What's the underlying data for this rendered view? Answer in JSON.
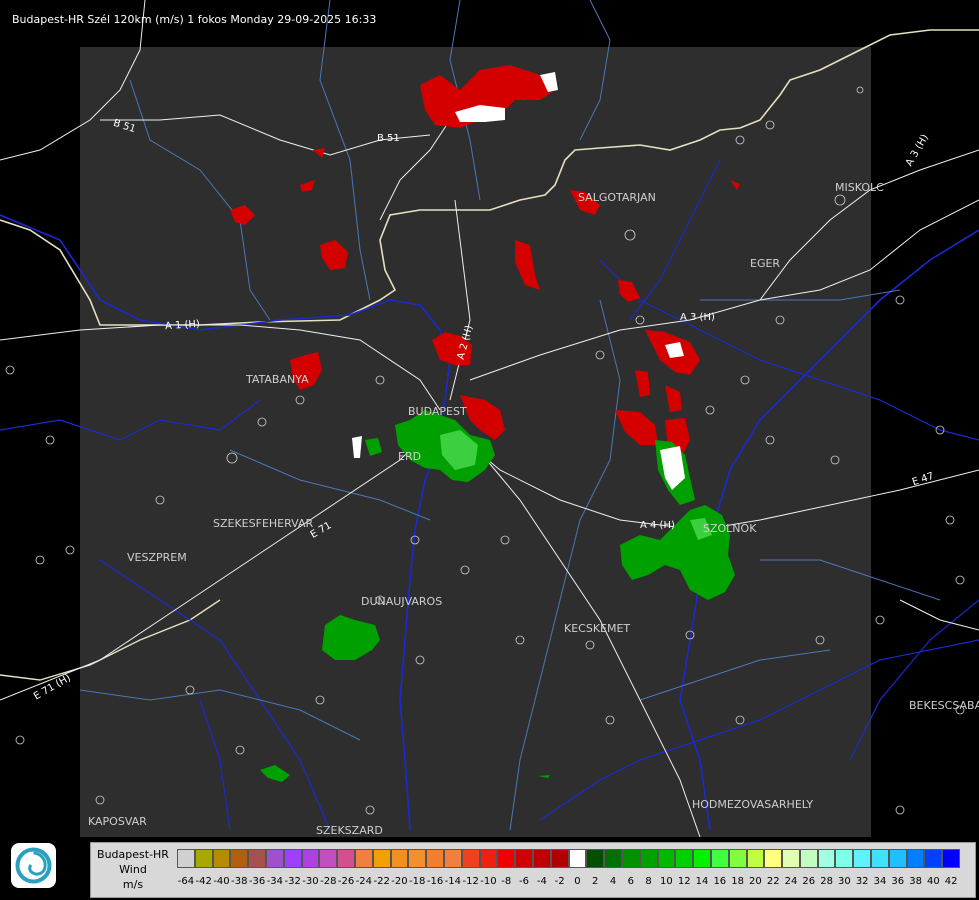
{
  "header": "Budapest-HR Szél 120km (m/s) 1 fokos Monday 29-09-2025 16:33",
  "cities": {
    "salgotarjan": "SALGOTARJAN",
    "miskolc": "MISKOLC",
    "eger": "EGER",
    "tatabanya": "TATABANYA",
    "budapest": "BUDAPEST",
    "erd": "ERD",
    "szekesfehervar": "SZEKESFEHERVAR",
    "veszprem": "VESZPREM",
    "dunaujvaros": "DUNAUJVAROS",
    "kecskemet": "KECSKEMET",
    "szolnok": "SZOLNOK",
    "bekescsaba": "BEKESCSABA",
    "hodmezovasarhely": "HODMEZOVASARHELY",
    "kaposvar": "KAPOSVAR",
    "szekszard": "SZEKSZARD"
  },
  "roads": {
    "b51_left": "B 51",
    "b51_right": "B 51",
    "a1": "A 1 (H)",
    "a2": "A 2 (H)",
    "a3": "A 3 (H)",
    "a3_ne": "A 3 (H)",
    "a4": "A 4 (H)",
    "e71_east": "E 71",
    "e71_west": "E 71 (H)",
    "e47": "E 47"
  },
  "legend": {
    "title_line1": "Budapest-HR",
    "title_line2": "Wind",
    "title_line3": "m/s",
    "ticks": [
      "-64",
      "-42",
      "-40",
      "-38",
      "-36",
      "-34",
      "-32",
      "-30",
      "-28",
      "-26",
      "-24",
      "-22",
      "-20",
      "-18",
      "-16",
      "-14",
      "-12",
      "-10",
      "-8",
      "-6",
      "-4",
      "-2",
      "0",
      "2",
      "4",
      "6",
      "8",
      "10",
      "12",
      "14",
      "16",
      "18",
      "20",
      "22",
      "24",
      "26",
      "28",
      "30",
      "32",
      "34",
      "36",
      "38",
      "40",
      "42"
    ],
    "colors": [
      "#d0d0d0",
      "#a8a800",
      "#b88a00",
      "#b06010",
      "#a85050",
      "#a050c8",
      "#a040ff",
      "#b040e0",
      "#c050c0",
      "#d05090",
      "#f08040",
      "#f0a000",
      "#f09020",
      "#f09030",
      "#f08030",
      "#f08040",
      "#f04020",
      "#f02010",
      "#f00000",
      "#d00000",
      "#c00000",
      "#b00000",
      "#ffffff",
      "#005000",
      "#007000",
      "#009000",
      "#00a000",
      "#00b800",
      "#00d000",
      "#00f000",
      "#40ff40",
      "#80ff40",
      "#c0ff40",
      "#ffff80",
      "#e0ffb0",
      "#c0ffc0",
      "#a0ffe0",
      "#80ffe8",
      "#60f0ff",
      "#40e0ff",
      "#20c0ff",
      "#0080ff",
      "#0040ff",
      "#0000ff"
    ]
  }
}
